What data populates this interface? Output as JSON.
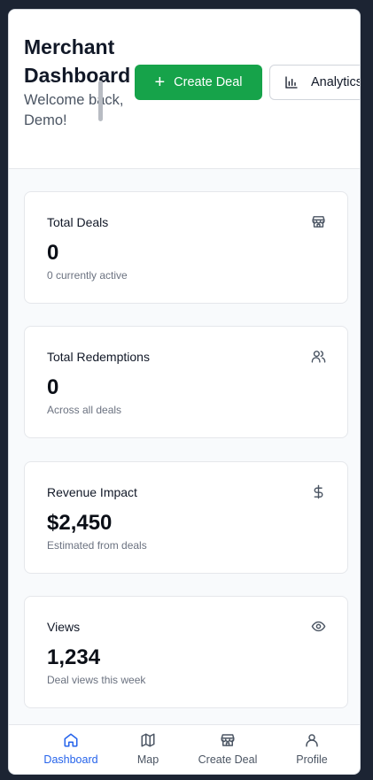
{
  "header": {
    "title": "Merchant Dashboard",
    "welcome": "Welcome back, Demo!",
    "create_deal_label": "Create Deal",
    "analytics_label": "Analytics"
  },
  "stats": [
    {
      "label": "Total Deals",
      "value": "0",
      "sub": "0 currently active",
      "icon": "store-icon"
    },
    {
      "label": "Total Redemptions",
      "value": "0",
      "sub": "Across all deals",
      "icon": "users-icon"
    },
    {
      "label": "Revenue Impact",
      "value": "$2,450",
      "sub": "Estimated from deals",
      "icon": "dollar-icon"
    },
    {
      "label": "Views",
      "value": "1,234",
      "sub": "Deal views this week",
      "icon": "eye-icon"
    }
  ],
  "nav": {
    "items": [
      {
        "label": "Dashboard",
        "icon": "home-icon",
        "active": true
      },
      {
        "label": "Map",
        "icon": "map-icon",
        "active": false
      },
      {
        "label": "Create Deal",
        "icon": "store-icon",
        "active": false
      },
      {
        "label": "Profile",
        "icon": "user-icon",
        "active": false
      }
    ]
  },
  "colors": {
    "primary": "#16a34a",
    "active_nav": "#2563eb",
    "background": "#1c2433"
  }
}
